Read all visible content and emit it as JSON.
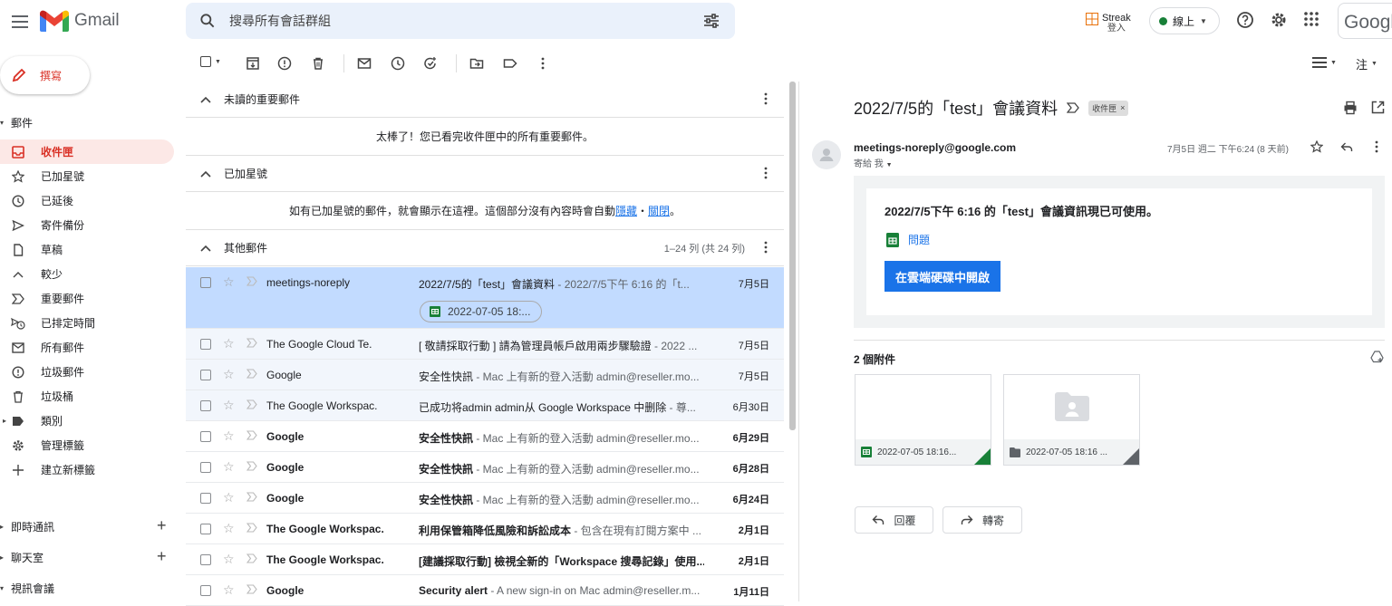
{
  "app": {
    "name": "Gmail"
  },
  "search": {
    "placeholder": "搜尋所有會話群組"
  },
  "header": {
    "streak_name": "Streak",
    "streak_login": "登入",
    "status_label": "線上",
    "account_text": "Google"
  },
  "sidebar": {
    "compose_label": "撰寫",
    "mail_section": "郵件",
    "items": [
      {
        "label": "收件匣",
        "icon": "inbox-icon",
        "active": true
      },
      {
        "label": "已加星號",
        "icon": "star-icon"
      },
      {
        "label": "已延後",
        "icon": "clock-icon"
      },
      {
        "label": "寄件備份",
        "icon": "send-icon"
      },
      {
        "label": "草稿",
        "icon": "draft-icon"
      },
      {
        "label": "較少",
        "icon": "chevron-up-icon"
      },
      {
        "label": "重要郵件",
        "icon": "important-icon"
      },
      {
        "label": "已排定時間",
        "icon": "scheduled-icon"
      },
      {
        "label": "所有郵件",
        "icon": "mail-icon"
      },
      {
        "label": "垃圾郵件",
        "icon": "spam-icon"
      },
      {
        "label": "垃圾桶",
        "icon": "trash-icon"
      },
      {
        "label": "類別",
        "icon": "label-icon"
      },
      {
        "label": "管理標籤",
        "icon": "gear-icon"
      },
      {
        "label": "建立新標籤",
        "icon": "plus-icon"
      }
    ],
    "chat_section": "即時通訊",
    "rooms_section": "聊天室",
    "meet_section": "視訊會議"
  },
  "toolbar": {
    "density_icon": "density-icon",
    "lang_label": "注"
  },
  "list": {
    "sections": {
      "unread_important": "未讀的重要郵件",
      "unread_empty": "太棒了！您已看完收件匣中的所有重要郵件。",
      "starred": "已加星號",
      "starred_empty": "如有已加星號的郵件，就會顯示在這裡。這個部分沒有內容時會自動",
      "starred_hide": "隱藏",
      "starred_sep": "・",
      "starred_close": "關閉",
      "starred_end": "。",
      "others": "其他郵件",
      "others_count": "1–24 列 (共 24 列)"
    },
    "rows": [
      {
        "sender": "meetings-noreply",
        "subject": "2022/7/5的「test」會議資料",
        "snippet": " - 2022/7/5下午 6:16 的「t...",
        "date": "7月5日",
        "state": "sel",
        "chip": "2022-07-05 18:..."
      },
      {
        "sender": "The Google Cloud Te.",
        "subject": "[ 敬請採取行動 ] 請為管理員帳戶啟用兩步驟驗證",
        "snippet": " - 2022 ...",
        "date": "7月5日",
        "state": "read"
      },
      {
        "sender": "Google",
        "subject": "安全性快訊",
        "snippet": " - Mac 上有新的登入活動 admin@reseller.mo...",
        "date": "7月5日",
        "state": "read"
      },
      {
        "sender": "The Google Workspac.",
        "subject": "已成功将admin admin从 Google Workspace 中删除",
        "snippet": " - 尊...",
        "date": "6月30日",
        "state": "read"
      },
      {
        "sender": "Google",
        "subject": "安全性快訊",
        "snippet": " - Mac 上有新的登入活動 admin@reseller.mo...",
        "date": "6月29日",
        "state": "unread"
      },
      {
        "sender": "Google",
        "subject": "安全性快訊",
        "snippet": " - Mac 上有新的登入活動 admin@reseller.mo...",
        "date": "6月28日",
        "state": "unread"
      },
      {
        "sender": "Google",
        "subject": "安全性快訊",
        "snippet": " - Mac 上有新的登入活動 admin@reseller.mo...",
        "date": "6月24日",
        "state": "unread"
      },
      {
        "sender": "The Google Workspac.",
        "subject": "利用保管箱降低風險和訴訟成本",
        "snippet": " - 包含在現有訂閱方案中 ...",
        "date": "2月1日",
        "state": "unread"
      },
      {
        "sender": "The Google Workspac.",
        "subject": "[建議採取行動] 檢視全新的「Workspace 搜尋記錄」使用...",
        "snippet": "",
        "date": "2月1日",
        "state": "unread"
      },
      {
        "sender": "Google",
        "subject": "Security alert",
        "snippet": " - A new sign-in on Mac admin@reseller.m...",
        "date": "1月11日",
        "state": "unread"
      }
    ]
  },
  "reading": {
    "subject": "2022/7/5的「test」會議資料",
    "label_badge": "收件匣",
    "badge_close": "×",
    "from": "meetings-noreply@google.com",
    "to": "寄給 我",
    "date": "7月5日 週二 下午6:24 (8 天前)",
    "card_title": "2022/7/5下午 6:16 的「test」會議資訊現已可使用。",
    "card_link": "問題",
    "open_button": "在雲端硬碟中開啟",
    "attach_count": "2 個附件",
    "attachments": [
      {
        "name": "2022-07-05 18:16...",
        "type": "sheets"
      },
      {
        "name": "2022-07-05 18:16 ...",
        "type": "folder"
      }
    ],
    "reply": "回覆",
    "forward": "轉寄"
  },
  "colors": {
    "accent_red": "#d93025",
    "blue": "#1a73e8",
    "selected_row": "#c2dbff",
    "sheets_green": "#188038"
  }
}
